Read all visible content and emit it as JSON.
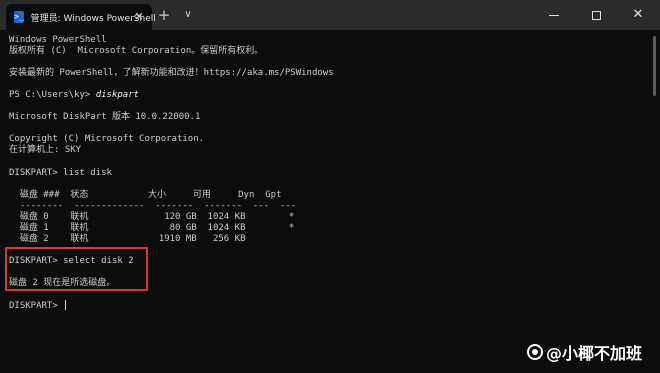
{
  "window": {
    "tab_title": "管理员: Windows PowerShell",
    "tab_icon_glyph": ">_",
    "close_tab_glyph": "✕",
    "new_tab_glyph": "+",
    "dropdown_glyph": "∨",
    "close_window_glyph": "✕"
  },
  "terminal": {
    "lines": [
      "Windows PowerShell",
      "版权所有 (C)  Microsoft Corporation。保留所有权利。",
      "",
      "安装最新的 PowerShell，了解新功能和改进！https://aka.ms/PSWindows",
      "",
      "",
      "",
      "Microsoft DiskPart 版本 10.0.22000.1",
      "",
      "Copyright (C) Microsoft Corporation.",
      "在计算机上: SKY",
      "",
      "DISKPART> list disk",
      "",
      "  磁盘 ###  状态           大小     可用     Dyn  Gpt",
      "  --------  -------------  -------  -------  ---  ---",
      "  磁盘 0    联机              120 GB  1024 KB        *",
      "  磁盘 1    联机               80 GB  1024 KB        *",
      "  磁盘 2    联机             1910 MB   256 KB",
      "",
      "DISKPART> select disk 2",
      "",
      "磁盘 2 现在是所选磁盘。",
      "",
      "DISKPART> "
    ],
    "prompt_line": {
      "prompt": "PS C:\\Users\\ky> ",
      "command": "diskpart"
    }
  },
  "watermark": {
    "text": "@小椰不加班"
  },
  "colors": {
    "highlight_border": "#e0322f",
    "background": "#0c0c0c",
    "foreground": "#cccccc"
  }
}
